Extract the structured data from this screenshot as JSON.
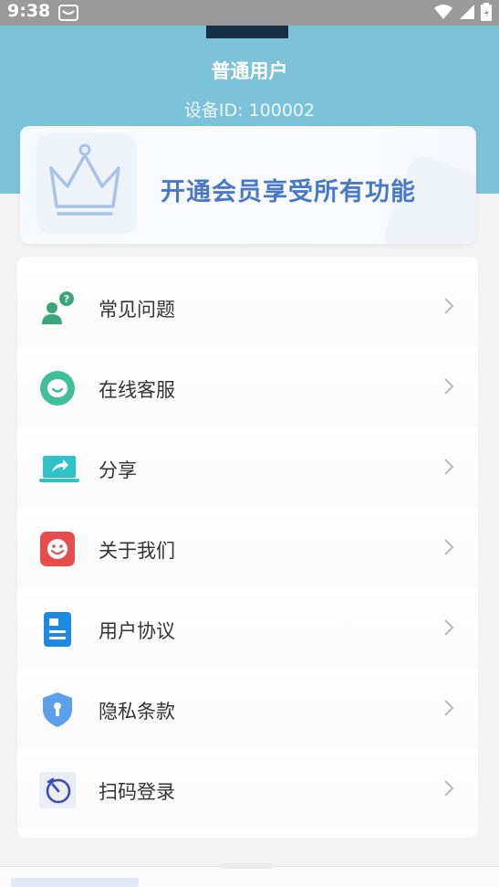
{
  "status_bar": {
    "time": "9:38"
  },
  "header": {
    "username": "普通用户",
    "device_id": "设备ID: 100002"
  },
  "vip_banner": {
    "text": "开通会员享受所有功能"
  },
  "menu": {
    "items": [
      {
        "label": "常见问题",
        "icon": "faq-icon"
      },
      {
        "label": "在线客服",
        "icon": "chat-icon"
      },
      {
        "label": "分享",
        "icon": "share-icon"
      },
      {
        "label": "关于我们",
        "icon": "about-icon"
      },
      {
        "label": "用户协议",
        "icon": "agreement-icon"
      },
      {
        "label": "隐私条款",
        "icon": "privacy-icon"
      },
      {
        "label": "扫码登录",
        "icon": "scan-icon"
      }
    ]
  },
  "colors": {
    "header": "#7cc3d9",
    "vip_text": "#4a78c8",
    "status_bar": "#9a9a9a"
  }
}
